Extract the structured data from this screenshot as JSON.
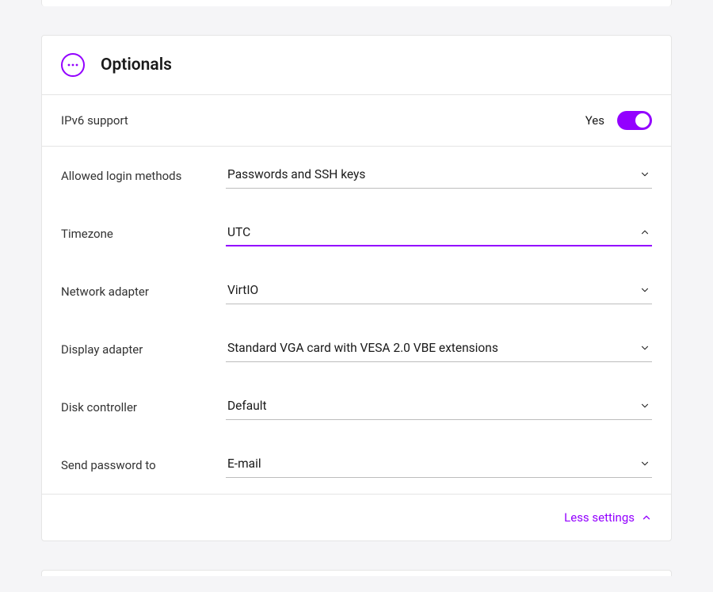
{
  "colors": {
    "accent": "#9300FF"
  },
  "section": {
    "title": "Optionals",
    "icon": "more-horizontal-icon"
  },
  "ipv6": {
    "label": "IPv6 support",
    "state_text": "Yes",
    "enabled": true
  },
  "fields": [
    {
      "key": "login_methods",
      "label": "Allowed login methods",
      "value": "Passwords and SSH keys",
      "open": false
    },
    {
      "key": "timezone",
      "label": "Timezone",
      "value": "UTC",
      "open": true
    },
    {
      "key": "network_adapter",
      "label": "Network adapter",
      "value": "VirtIO",
      "open": false
    },
    {
      "key": "display_adapter",
      "label": "Display adapter",
      "value": "Standard VGA card with VESA 2.0 VBE extensions",
      "open": false
    },
    {
      "key": "disk_controller",
      "label": "Disk controller",
      "value": "Default",
      "open": false
    },
    {
      "key": "send_password",
      "label": "Send password to",
      "value": "E-mail",
      "open": false
    }
  ],
  "footer": {
    "less_settings": "Less settings"
  }
}
